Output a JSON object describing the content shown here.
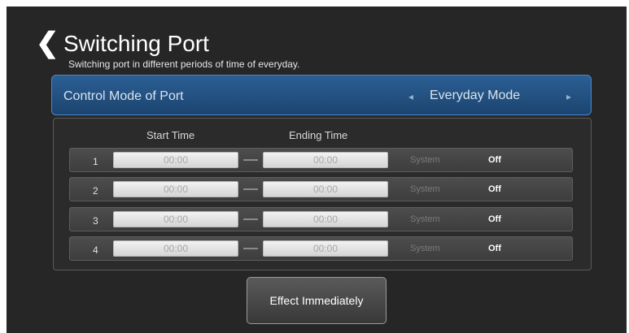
{
  "header": {
    "back_glyph": "❮",
    "title": "Switching Port",
    "subtitle": "Switching port in different periods of time of everyday."
  },
  "mode": {
    "label": "Control Mode of Port",
    "value": "Everyday Mode",
    "left_arrow": "◂",
    "right_arrow": "▸"
  },
  "columns": {
    "start": "Start Time",
    "end": "Ending Time"
  },
  "rows": [
    {
      "num": "1",
      "start": "00:00",
      "end": "00:00",
      "system": "System",
      "status": "Off"
    },
    {
      "num": "2",
      "start": "00:00",
      "end": "00:00",
      "system": "System",
      "status": "Off"
    },
    {
      "num": "3",
      "start": "00:00",
      "end": "00:00",
      "system": "System",
      "status": "Off"
    },
    {
      "num": "4",
      "start": "00:00",
      "end": "00:00",
      "system": "System",
      "status": "Off"
    }
  ],
  "actions": {
    "effect": "Effect Immediately"
  },
  "colors": {
    "background": "#262626",
    "mode_bar": "#2b5f94",
    "row": "#4d4d4d"
  },
  "icons": {
    "back": "chevron-left-icon",
    "prev": "triangle-left-icon",
    "next": "triangle-right-icon"
  }
}
